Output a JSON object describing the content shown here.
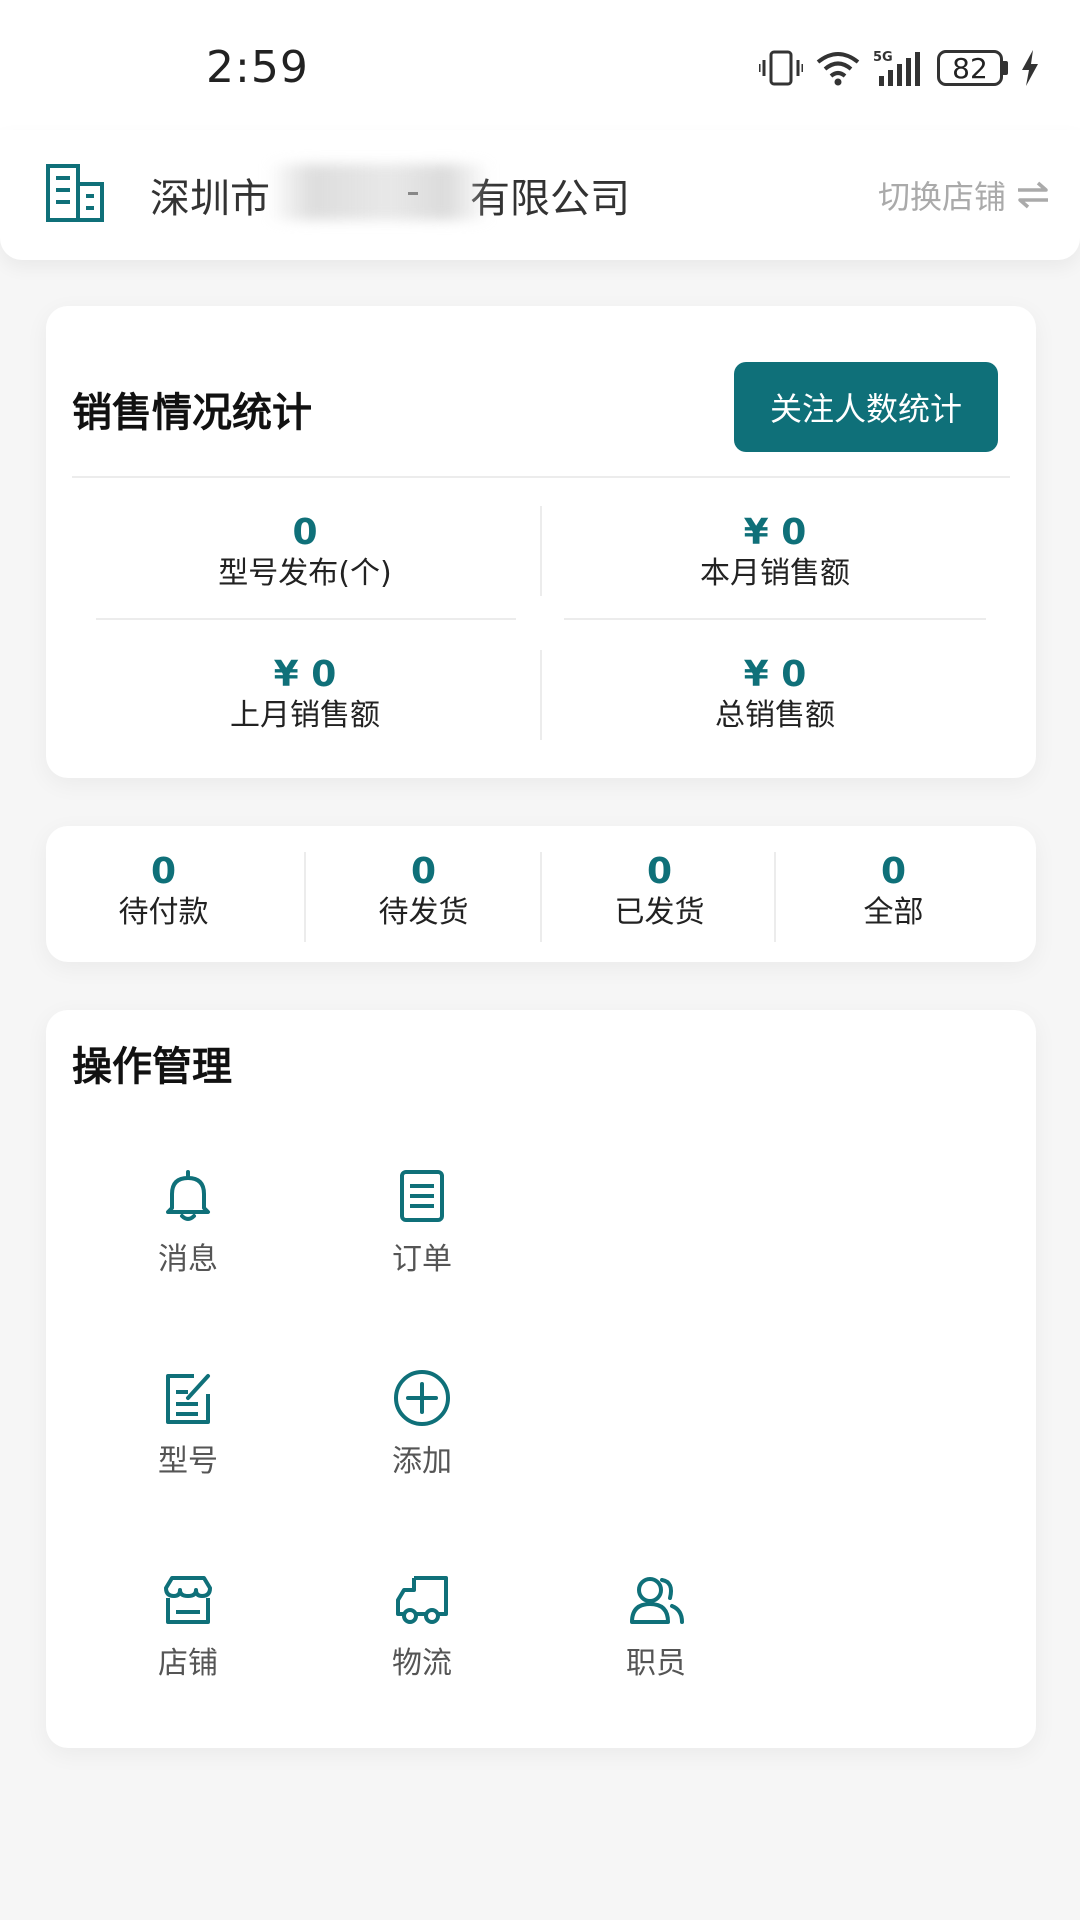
{
  "status_bar": {
    "time": "2:59",
    "battery_level": "82",
    "icons": [
      "vibrate-icon",
      "wifi-icon",
      "signal-5g-icon",
      "battery-icon",
      "charging-icon"
    ]
  },
  "header": {
    "company_prefix": "深圳市",
    "company_suffix": "有限公司",
    "switch_label": "切换店铺",
    "icon": "building-icon"
  },
  "sales": {
    "title": "销售情况统计",
    "follow_button": "关注人数统计",
    "stats": [
      {
        "value": "0",
        "label": "型号发布(个)"
      },
      {
        "value": "¥ 0",
        "label": "本月销售额"
      },
      {
        "value": "¥ 0",
        "label": "上月销售额"
      },
      {
        "value": "¥ 0",
        "label": "总销售额"
      }
    ]
  },
  "orders": [
    {
      "value": "0",
      "label": "待付款"
    },
    {
      "value": "0",
      "label": "待发货"
    },
    {
      "value": "0",
      "label": "已发货"
    },
    {
      "value": "0",
      "label": "全部"
    }
  ],
  "operations": {
    "title": "操作管理",
    "items": [
      {
        "label": "消息",
        "icon": "bell-icon"
      },
      {
        "label": "订单",
        "icon": "order-icon"
      },
      {
        "label": "型号",
        "icon": "edit-icon"
      },
      {
        "label": "添加",
        "icon": "add-circle-icon"
      },
      {
        "label": "店铺",
        "icon": "store-icon"
      },
      {
        "label": "物流",
        "icon": "truck-icon"
      },
      {
        "label": "职员",
        "icon": "staff-icon"
      }
    ]
  },
  "colors": {
    "accent": "#0f7079",
    "background": "#f6f6f6",
    "card": "#ffffff",
    "muted_text": "#aaaaaa"
  }
}
